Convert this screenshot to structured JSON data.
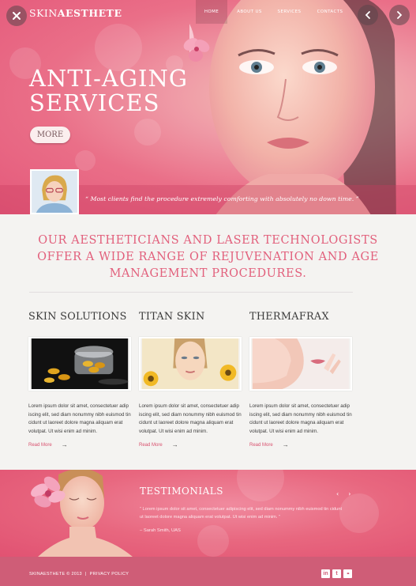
{
  "window": {
    "close_icon": "close-x-icon",
    "prev_icon": "chevron-left-icon",
    "next_icon": "chevron-right-icon"
  },
  "brand": {
    "part1": "SKIN",
    "part2": "AESTHETE"
  },
  "nav": [
    {
      "label": "HOME",
      "active": true
    },
    {
      "label": "ABOUT US",
      "active": false
    },
    {
      "label": "SERVICES",
      "active": false
    },
    {
      "label": "CONTACTS",
      "active": false
    }
  ],
  "hero": {
    "title_line1": "ANTI-AGING",
    "title_line2": "SERVICES",
    "more_label": "MORE",
    "quote": "“ Most clients find the procedure extremely comforting with absolutely no down time. ”"
  },
  "intro": "OUR AESTHETICIANS AND LASER TECHNOLOGISTS OFFER A WIDE RANGE OF REJUVENATION AND AGE MANAGEMENT PROCEDURES.",
  "services": [
    {
      "title": "SKIN SOLUTIONS",
      "text": "Lorem ipsum dolor sit amet, consectetuer adip iscing elit, sed diam nonummy nibh euismod tin cidunt ut laoreet dolore magna aliquam erat volutpat. Ut wisi enim ad minim.",
      "link": "Read More"
    },
    {
      "title": "TITAN SKIN",
      "text": "Lorem ipsum dolor sit amet, consectetuer adip iscing elit, sed diam nonummy nibh euismod tin cidunt ut laoreet dolore magna aliquam erat volutpat. Ut wisi enim ad minim.",
      "link": "Read More"
    },
    {
      "title": "THERMAFRAX",
      "text": "Lorem ipsum dolor sit amet, consectetuer adip iscing elit, sed diam nonummy nibh euismod tin cidunt ut laoreet dolore magna aliquam erat volutpat. Ut wisi enim ad minim.",
      "link": "Read More"
    }
  ],
  "testimonials": {
    "title": "TESTIMONIALS",
    "prev": "‹",
    "next": "›",
    "text": "“ Lorem ipsum dolor sit amet, consectetuer adipiscing elit, sed diam nonummy nibh euismod tin cidunt ut laoreet dolore magna aliquam erat volutpat. Ut wisi enim ad minim. ”",
    "author": "– Sarah Smith, UAS"
  },
  "footer": {
    "copyright": "SKINAESTHETE © 2013",
    "separator": "|",
    "privacy": "PRIVACY POLICY",
    "social": [
      {
        "icon": "linkedin-icon",
        "glyph": "in"
      },
      {
        "icon": "twitter-icon",
        "glyph": "t"
      },
      {
        "icon": "flickr-icon",
        "glyph": "••"
      }
    ]
  },
  "colors": {
    "accent": "#e2607c",
    "hero_pink": "#e8677f",
    "footer": "#cf5d77"
  }
}
